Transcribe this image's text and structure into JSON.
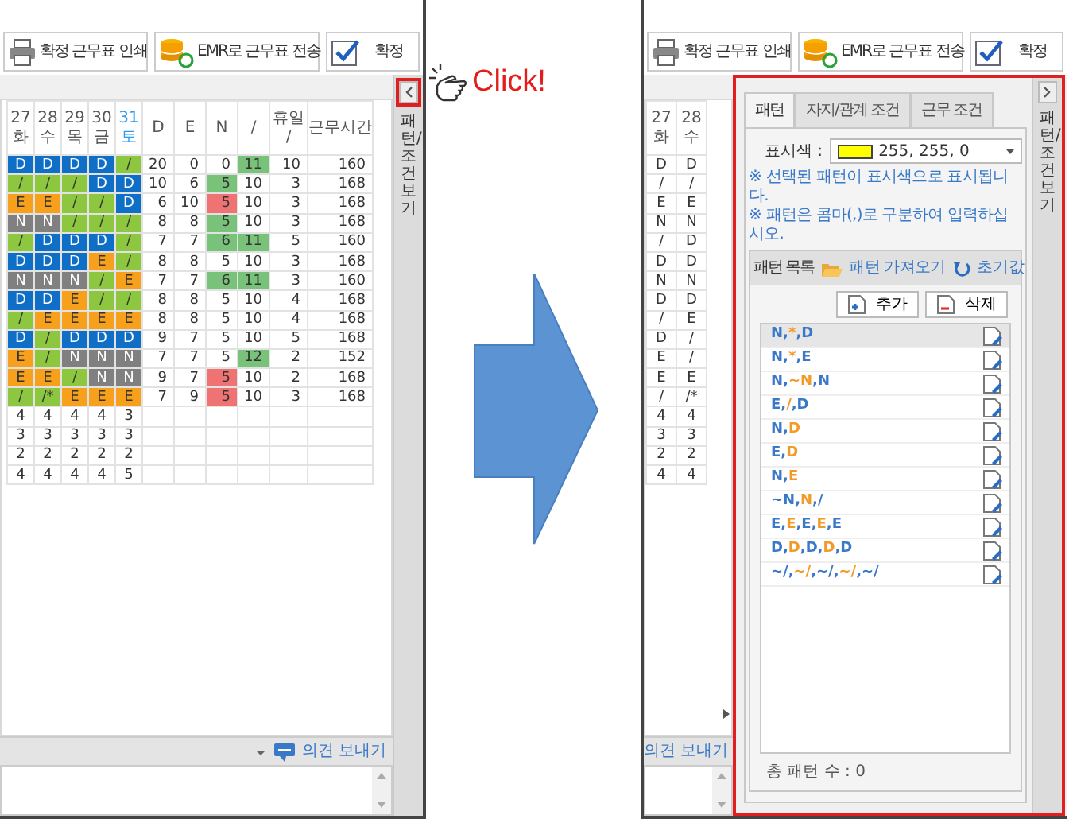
{
  "left_screen": {
    "toolbar": [
      {
        "kind": "print",
        "label": "확정 근무표 인쇄"
      },
      {
        "kind": "database",
        "label": "EMR로 근무표 전송"
      },
      {
        "kind": "confirm",
        "label": "확정"
      }
    ],
    "table": {
      "day_columns": [
        {
          "day": "27",
          "weekday": "화",
          "weekend": false
        },
        {
          "day": "28",
          "weekday": "수",
          "weekend": false
        },
        {
          "day": "29",
          "weekday": "목",
          "weekend": false
        },
        {
          "day": "30",
          "weekday": "금",
          "weekend": false
        },
        {
          "day": "31",
          "weekday": "토",
          "weekend": true
        }
      ],
      "summary_columns": [
        "D",
        "E",
        "N",
        "/",
        "휴일 /",
        "근무시간"
      ],
      "rows": [
        {
          "shifts": [
            {
              "code": "D",
              "kind": "day"
            },
            {
              "code": "D",
              "kind": "day"
            },
            {
              "code": "D",
              "kind": "day"
            },
            {
              "code": "D",
              "kind": "day"
            },
            {
              "code": "/",
              "kind": "off"
            }
          ],
          "totals": [
            {
              "value": "20"
            },
            {
              "value": "0"
            },
            {
              "value": "0"
            },
            {
              "value": "11",
              "color": "#79c27a"
            },
            {
              "value": "10"
            },
            {
              "value": "160"
            }
          ]
        },
        {
          "shifts": [
            {
              "code": "/",
              "kind": "off"
            },
            {
              "code": "/",
              "kind": "off"
            },
            {
              "code": "/",
              "kind": "off"
            },
            {
              "code": "D",
              "kind": "day"
            },
            {
              "code": "D",
              "kind": "day"
            }
          ],
          "totals": [
            {
              "value": "10"
            },
            {
              "value": "6"
            },
            {
              "value": "5",
              "color": "#79c27a"
            },
            {
              "value": "10"
            },
            {
              "value": "3"
            },
            {
              "value": "168"
            }
          ]
        },
        {
          "shifts": [
            {
              "code": "E",
              "kind": "evening"
            },
            {
              "code": "E",
              "kind": "evening"
            },
            {
              "code": "/",
              "kind": "off"
            },
            {
              "code": "/",
              "kind": "off"
            },
            {
              "code": "D",
              "kind": "day"
            }
          ],
          "totals": [
            {
              "value": "6"
            },
            {
              "value": "10"
            },
            {
              "value": "5",
              "color": "#f07373"
            },
            {
              "value": "10"
            },
            {
              "value": "3"
            },
            {
              "value": "168"
            }
          ]
        },
        {
          "shifts": [
            {
              "code": "N",
              "kind": "night"
            },
            {
              "code": "N",
              "kind": "night"
            },
            {
              "code": "/",
              "kind": "off"
            },
            {
              "code": "/",
              "kind": "off"
            },
            {
              "code": "/",
              "kind": "off"
            }
          ],
          "totals": [
            {
              "value": "8"
            },
            {
              "value": "8"
            },
            {
              "value": "5",
              "color": "#79c27a"
            },
            {
              "value": "10"
            },
            {
              "value": "3"
            },
            {
              "value": "168"
            }
          ]
        },
        {
          "shifts": [
            {
              "code": "/",
              "kind": "off"
            },
            {
              "code": "D",
              "kind": "day"
            },
            {
              "code": "D",
              "kind": "day"
            },
            {
              "code": "D",
              "kind": "day"
            },
            {
              "code": "/",
              "kind": "off"
            }
          ],
          "totals": [
            {
              "value": "7"
            },
            {
              "value": "7"
            },
            {
              "value": "6",
              "color": "#79c27a"
            },
            {
              "value": "11",
              "color": "#79c27a"
            },
            {
              "value": "5"
            },
            {
              "value": "160"
            }
          ]
        },
        {
          "shifts": [
            {
              "code": "D",
              "kind": "day"
            },
            {
              "code": "D",
              "kind": "day"
            },
            {
              "code": "D",
              "kind": "day"
            },
            {
              "code": "E",
              "kind": "evening"
            },
            {
              "code": "/",
              "kind": "off"
            }
          ],
          "totals": [
            {
              "value": "8"
            },
            {
              "value": "8"
            },
            {
              "value": "5"
            },
            {
              "value": "10"
            },
            {
              "value": "3"
            },
            {
              "value": "168"
            }
          ]
        },
        {
          "shifts": [
            {
              "code": "N",
              "kind": "night"
            },
            {
              "code": "N",
              "kind": "night"
            },
            {
              "code": "N",
              "kind": "night"
            },
            {
              "code": "/",
              "kind": "off"
            },
            {
              "code": "E",
              "kind": "evening"
            }
          ],
          "totals": [
            {
              "value": "7"
            },
            {
              "value": "7"
            },
            {
              "value": "6",
              "color": "#79c27a"
            },
            {
              "value": "11",
              "color": "#79c27a"
            },
            {
              "value": "3"
            },
            {
              "value": "160"
            }
          ]
        },
        {
          "shifts": [
            {
              "code": "D",
              "kind": "day"
            },
            {
              "code": "D",
              "kind": "day"
            },
            {
              "code": "E",
              "kind": "evening"
            },
            {
              "code": "/",
              "kind": "off"
            },
            {
              "code": "/",
              "kind": "off"
            }
          ],
          "totals": [
            {
              "value": "8"
            },
            {
              "value": "8"
            },
            {
              "value": "5"
            },
            {
              "value": "10"
            },
            {
              "value": "4"
            },
            {
              "value": "168"
            }
          ]
        },
        {
          "shifts": [
            {
              "code": "/",
              "kind": "off"
            },
            {
              "code": "E",
              "kind": "evening"
            },
            {
              "code": "E",
              "kind": "evening"
            },
            {
              "code": "E",
              "kind": "evening"
            },
            {
              "code": "E",
              "kind": "evening"
            }
          ],
          "totals": [
            {
              "value": "8"
            },
            {
              "value": "8"
            },
            {
              "value": "5"
            },
            {
              "value": "10"
            },
            {
              "value": "4"
            },
            {
              "value": "168"
            }
          ]
        },
        {
          "shifts": [
            {
              "code": "D",
              "kind": "day"
            },
            {
              "code": "/",
              "kind": "off"
            },
            {
              "code": "D",
              "kind": "day"
            },
            {
              "code": "D",
              "kind": "day"
            },
            {
              "code": "D",
              "kind": "day"
            }
          ],
          "totals": [
            {
              "value": "9"
            },
            {
              "value": "7"
            },
            {
              "value": "5"
            },
            {
              "value": "10"
            },
            {
              "value": "5"
            },
            {
              "value": "168"
            }
          ]
        },
        {
          "shifts": [
            {
              "code": "E",
              "kind": "evening"
            },
            {
              "code": "/",
              "kind": "off"
            },
            {
              "code": "N",
              "kind": "night"
            },
            {
              "code": "N",
              "kind": "night"
            },
            {
              "code": "N",
              "kind": "night"
            }
          ],
          "totals": [
            {
              "value": "7"
            },
            {
              "value": "7"
            },
            {
              "value": "5"
            },
            {
              "value": "12",
              "color": "#79c27a"
            },
            {
              "value": "2"
            },
            {
              "value": "152"
            }
          ]
        },
        {
          "shifts": [
            {
              "code": "E",
              "kind": "evening"
            },
            {
              "code": "E",
              "kind": "evening"
            },
            {
              "code": "/",
              "kind": "off"
            },
            {
              "code": "N",
              "kind": "night"
            },
            {
              "code": "N",
              "kind": "night"
            }
          ],
          "totals": [
            {
              "value": "9"
            },
            {
              "value": "7"
            },
            {
              "value": "5",
              "color": "#f07373"
            },
            {
              "value": "10"
            },
            {
              "value": "2"
            },
            {
              "value": "168"
            }
          ]
        },
        {
          "shifts": [
            {
              "code": "/",
              "kind": "off"
            },
            {
              "code": "/*",
              "kind": "off"
            },
            {
              "code": "E",
              "kind": "evening"
            },
            {
              "code": "E",
              "kind": "evening"
            },
            {
              "code": "E",
              "kind": "evening"
            }
          ],
          "totals": [
            {
              "value": "7"
            },
            {
              "value": "9"
            },
            {
              "value": "5",
              "color": "#f07373"
            },
            {
              "value": "10"
            },
            {
              "value": "3"
            },
            {
              "value": "168"
            }
          ]
        }
      ],
      "count_rows": [
        [
          "4",
          "4",
          "4",
          "4",
          "3"
        ],
        [
          "3",
          "3",
          "3",
          "3",
          "3"
        ],
        [
          "2",
          "2",
          "2",
          "2",
          "2"
        ],
        [
          "4",
          "4",
          "4",
          "4",
          "5"
        ]
      ]
    },
    "side_tab": {
      "label": "패턴/조건 보기",
      "highlighted": true
    },
    "feedback": {
      "label": "의견 보내기"
    }
  },
  "callout": {
    "text": "Click!"
  },
  "right_screen": {
    "toolbar": [
      {
        "kind": "print",
        "label": "확정 근무표 인쇄"
      },
      {
        "kind": "database",
        "label": "EMR로 근무표 전송"
      },
      {
        "kind": "confirm",
        "label": "확정"
      }
    ],
    "table": {
      "day_columns": [
        {
          "day": "27",
          "weekday": "화"
        },
        {
          "day": "28",
          "weekday": "수"
        }
      ],
      "rows": [
        [
          "D",
          "D"
        ],
        [
          "/",
          "/"
        ],
        [
          "E",
          "E"
        ],
        [
          "N",
          "N"
        ],
        [
          "/",
          "D"
        ],
        [
          "D",
          "D"
        ],
        [
          "N",
          "N"
        ],
        [
          "D",
          "D"
        ],
        [
          "/",
          "E"
        ],
        [
          "D",
          "/"
        ],
        [
          "E",
          "/"
        ],
        [
          "E",
          "E"
        ],
        [
          "/",
          "/*"
        ]
      ],
      "count_rows": [
        [
          "4",
          "4"
        ],
        [
          "3",
          "3"
        ],
        [
          "2",
          "2"
        ],
        [
          "4",
          "4"
        ]
      ]
    },
    "pattern_panel": {
      "tabs": [
        {
          "label": "패턴",
          "selected": true
        },
        {
          "label": "자지/관계 조건",
          "selected": false
        },
        {
          "label": "근무 조건",
          "selected": false
        }
      ],
      "color_label": "표시색 :",
      "color_value": "255, 255, 0",
      "color": "#ffff00",
      "notes": [
        "※ 선택된 패턴이 표시색으로 표시됩니다.",
        "※ 패턴은 콤마(,)로 구분하여 입력하십시오."
      ],
      "list_title": "패턴 목록",
      "import_label": "패턴 가져오기",
      "reset_label": "초기값",
      "buttons": [
        {
          "kind": "add",
          "label": "추가"
        },
        {
          "kind": "delete",
          "label": "삭제"
        }
      ],
      "patterns": [
        {
          "text": "N,*,D",
          "selected": true
        },
        {
          "text": "N,*,E",
          "selected": false
        },
        {
          "text": "N,~N,N",
          "selected": false
        },
        {
          "text": "E,/,D",
          "selected": false
        },
        {
          "text": "N,D",
          "selected": false
        },
        {
          "text": "E,D",
          "selected": false
        },
        {
          "text": "N,E",
          "selected": false
        },
        {
          "text": "~N,N,/",
          "selected": false
        },
        {
          "text": "E,E,E,E,E",
          "selected": false
        },
        {
          "text": "D,D,D,D,D",
          "selected": false
        },
        {
          "text": "~/,~/,~/,~/,~/",
          "selected": false
        }
      ],
      "total": "총 패턴 수 : 0"
    },
    "side_tab": {
      "label": "패턴/조건 보기"
    },
    "feedback": {
      "label": "의견 보내기"
    }
  }
}
